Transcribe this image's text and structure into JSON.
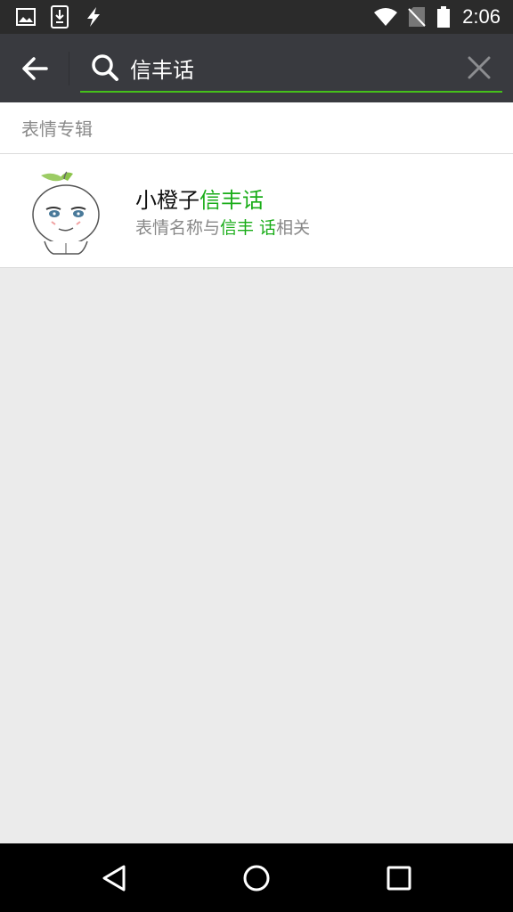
{
  "status_bar": {
    "time": "2:06",
    "icons": [
      "image-icon",
      "download-icon",
      "flash-icon",
      "wifi-icon",
      "no-sim-icon",
      "battery-icon"
    ]
  },
  "search": {
    "query": "信丰话",
    "accent_color": "#45c01a"
  },
  "results": {
    "section_title": "表情专辑",
    "items": [
      {
        "title_prefix": "小橙子",
        "title_highlight": "信丰话",
        "subtitle_prefix": "表情名称与",
        "subtitle_highlight": "信丰 话",
        "subtitle_suffix": "相关"
      }
    ]
  },
  "nav_bar": {
    "icons": [
      "back-triangle-icon",
      "home-circle-icon",
      "recents-square-icon"
    ]
  },
  "colors": {
    "status_bar_bg": "#2b2b2b",
    "search_bar_bg": "#393a3f",
    "highlight": "#1aad19",
    "page_bg": "#ebebeb"
  }
}
